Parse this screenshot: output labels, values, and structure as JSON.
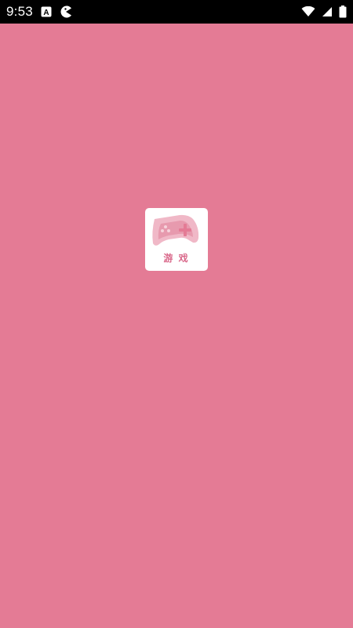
{
  "status_bar": {
    "time": "9:53",
    "icons": [
      "accessibility-a-icon",
      "pacman-icon",
      "wifi-icon",
      "signal-icon",
      "battery-icon"
    ]
  },
  "splash": {
    "logo_text": "游 戏"
  },
  "colors": {
    "background": "#e47b95",
    "status_bar": "#000000",
    "logo_bg": "#ffffff",
    "logo_accent": "#e47b95"
  }
}
